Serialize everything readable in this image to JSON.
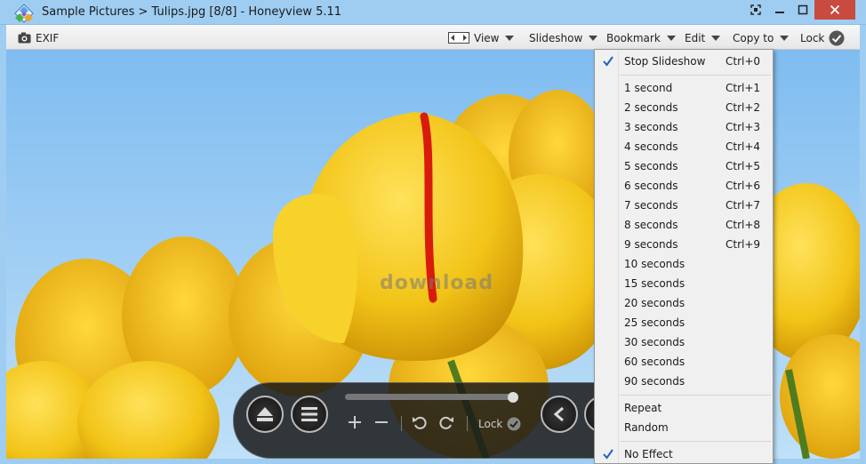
{
  "window": {
    "title": "Sample Pictures > Tulips.jpg [8/8] - Honeyview 5.11"
  },
  "toolbar": {
    "exif_label": "EXIF",
    "view_label": "View",
    "slideshow_label": "Slideshow",
    "bookmark_label": "Bookmark",
    "edit_label": "Edit",
    "copy_to_label": "Copy to",
    "lock_label": "Lock"
  },
  "watermark": "download",
  "control_bar": {
    "lock_label": "Lock",
    "slider_position": 0.97
  },
  "slideshow_menu": {
    "top": [
      {
        "label": "Stop Slideshow",
        "shortcut": "Ctrl+0",
        "checked": true
      }
    ],
    "intervals": [
      {
        "label": "1 second",
        "shortcut": "Ctrl+1"
      },
      {
        "label": "2 seconds",
        "shortcut": "Ctrl+2"
      },
      {
        "label": "3 seconds",
        "shortcut": "Ctrl+3"
      },
      {
        "label": "4 seconds",
        "shortcut": "Ctrl+4"
      },
      {
        "label": "5 seconds",
        "shortcut": "Ctrl+5"
      },
      {
        "label": "6 seconds",
        "shortcut": "Ctrl+6"
      },
      {
        "label": "7 seconds",
        "shortcut": "Ctrl+7"
      },
      {
        "label": "8 seconds",
        "shortcut": "Ctrl+8"
      },
      {
        "label": "9 seconds",
        "shortcut": "Ctrl+9"
      },
      {
        "label": "10 seconds",
        "shortcut": ""
      },
      {
        "label": "15 seconds",
        "shortcut": ""
      },
      {
        "label": "20 seconds",
        "shortcut": ""
      },
      {
        "label": "25 seconds",
        "shortcut": ""
      },
      {
        "label": "30 seconds",
        "shortcut": ""
      },
      {
        "label": "60 seconds",
        "shortcut": ""
      },
      {
        "label": "90 seconds",
        "shortcut": ""
      }
    ],
    "order": [
      {
        "label": "Repeat"
      },
      {
        "label": "Random"
      }
    ],
    "effects": [
      {
        "label": "No Effect",
        "checked": true
      }
    ]
  },
  "colors": {
    "titlebar": "#9fcdf2",
    "close_button": "#c94a3f",
    "check_accent": "#1f5fbf",
    "sky": "#8cc6f2",
    "tulip": "#f2c418"
  },
  "icons": [
    "app-icon",
    "fullscreen-icon",
    "minimize-icon",
    "maximize-icon",
    "close-icon",
    "camera-icon",
    "view-arrows-icon",
    "checkmark-icon",
    "eject-icon",
    "menu-icon",
    "zoom-in-icon",
    "zoom-out-icon",
    "rotate-left-icon",
    "rotate-right-icon",
    "previous-icon"
  ]
}
